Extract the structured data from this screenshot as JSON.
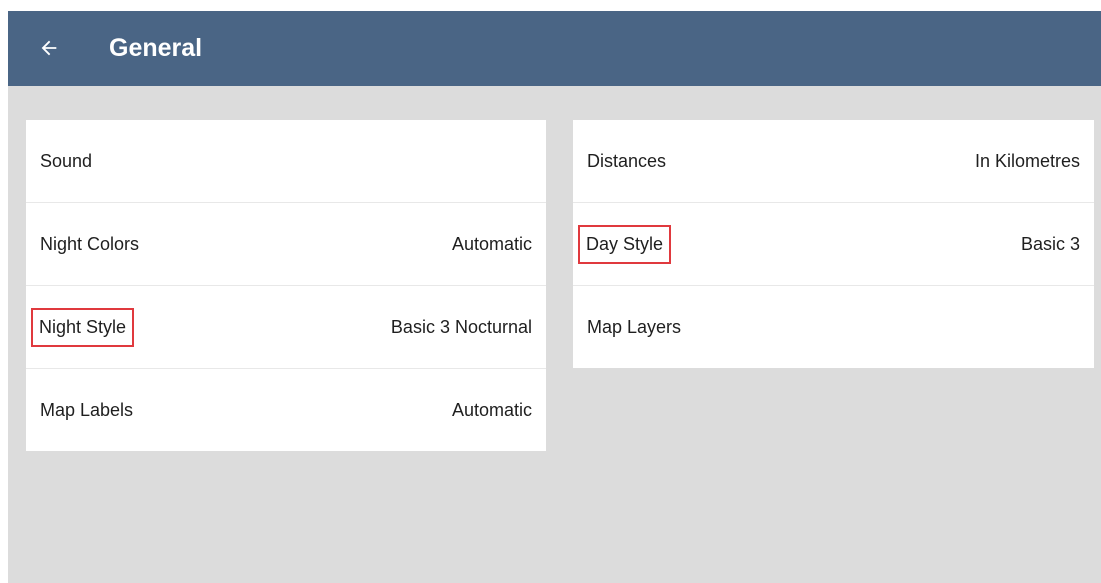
{
  "header": {
    "title": "General",
    "back_icon": "arrow-left-icon",
    "background_color": "#4a6585"
  },
  "left_panel": {
    "items": [
      {
        "label": "Sound",
        "value": ""
      },
      {
        "label": "Night Colors",
        "value": "Automatic"
      },
      {
        "label": "Night Style",
        "value": "Basic 3 Nocturnal",
        "highlighted": true
      },
      {
        "label": "Map Labels",
        "value": "Automatic"
      }
    ]
  },
  "right_panel": {
    "items": [
      {
        "label": "Distances",
        "value": "In Kilometres"
      },
      {
        "label": "Day Style",
        "value": "Basic 3",
        "highlighted": true
      },
      {
        "label": "Map Layers",
        "value": ""
      }
    ]
  },
  "colors": {
    "highlight_box": "#e0393e",
    "screen_background": "#dcdcdc"
  }
}
